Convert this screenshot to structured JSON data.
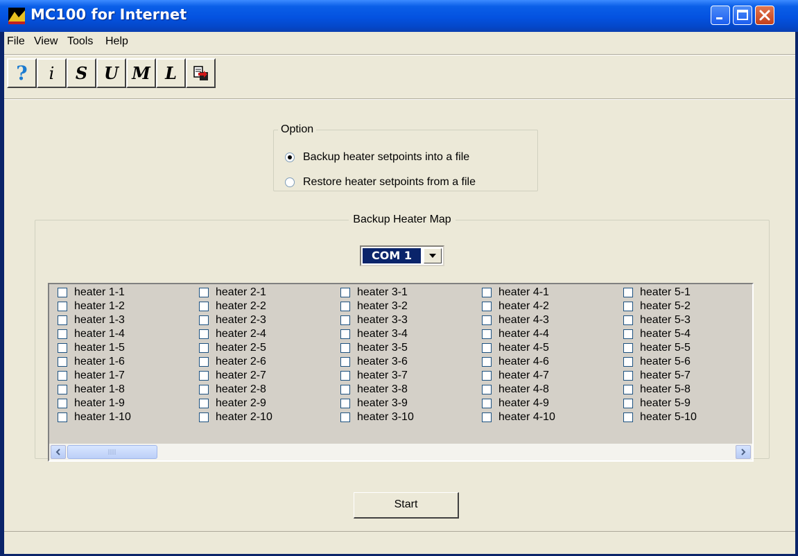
{
  "window": {
    "title": "MC100 for Internet"
  },
  "menu": {
    "items": [
      "File",
      "View",
      "Tools",
      "Help"
    ]
  },
  "toolbar": {
    "buttons": [
      {
        "icon": "help-icon",
        "glyph": "?"
      },
      {
        "icon": "info-icon",
        "glyph": "i"
      },
      {
        "icon": "s-icon",
        "glyph": "S"
      },
      {
        "icon": "u-icon",
        "glyph": "U"
      },
      {
        "icon": "m-icon",
        "glyph": "M"
      },
      {
        "icon": "l-icon",
        "glyph": "L"
      },
      {
        "icon": "copy-file-icon",
        "glyph": ""
      }
    ]
  },
  "option": {
    "legend": "Option",
    "choices": [
      {
        "label": "Backup heater setpoints into a file",
        "selected": true
      },
      {
        "label": "Restore heater setpoints from a file",
        "selected": false
      }
    ]
  },
  "heater_map": {
    "legend": "Backup Heater Map",
    "com_port": "COM 1",
    "columns": [
      [
        "heater 1-1",
        "heater 1-2",
        "heater 1-3",
        "heater 1-4",
        "heater 1-5",
        "heater 1-6",
        "heater 1-7",
        "heater 1-8",
        "heater 1-9",
        "heater 1-10"
      ],
      [
        "heater 2-1",
        "heater 2-2",
        "heater 2-3",
        "heater 2-4",
        "heater 2-5",
        "heater 2-6",
        "heater 2-7",
        "heater 2-8",
        "heater 2-9",
        "heater 2-10"
      ],
      [
        "heater 3-1",
        "heater 3-2",
        "heater 3-3",
        "heater 3-4",
        "heater 3-5",
        "heater 3-6",
        "heater 3-7",
        "heater 3-8",
        "heater 3-9",
        "heater 3-10"
      ],
      [
        "heater 4-1",
        "heater 4-2",
        "heater 4-3",
        "heater 4-4",
        "heater 4-5",
        "heater 4-6",
        "heater 4-7",
        "heater 4-8",
        "heater 4-9",
        "heater 4-10"
      ],
      [
        "heater 5-1",
        "heater 5-2",
        "heater 5-3",
        "heater 5-4",
        "heater 5-5",
        "heater 5-6",
        "heater 5-7",
        "heater 5-8",
        "heater 5-9",
        "heater 5-10"
      ]
    ]
  },
  "start_button": {
    "label": "Start"
  },
  "colors": {
    "titlebar": "#0452e0",
    "window_bg": "#ece9d8",
    "list_bg": "#d4d0c8",
    "selection": "#0a246a"
  }
}
